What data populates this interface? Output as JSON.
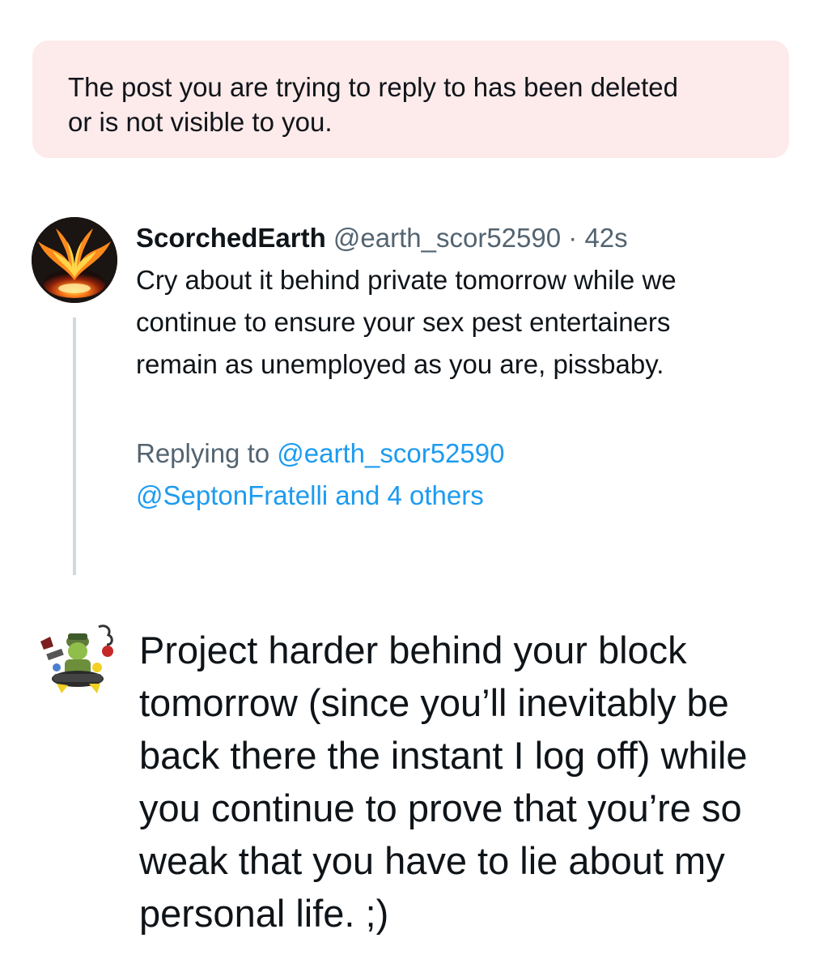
{
  "notice": {
    "text": "The post you are trying to reply to has been deleted or is not visible to you."
  },
  "parent_tweet": {
    "display_name": "ScorchedEarth",
    "handle": "@earth_scor52590",
    "separator": "·",
    "timestamp": "42s",
    "text": "Cry about it behind private tomorrow while we continue to ensure your sex pest entertainers remain as unemployed as you are, pissbaby.",
    "replying_to_label": "Replying to",
    "replying_to_handle": "@earth_scor52590",
    "replying_to_more": "@SeptonFratelli and 4 others"
  },
  "reply_draft": {
    "text": "Project harder behind your block tomorrow (since you’ll inevitably be back there the instant I log off) while you continue to prove that you’re so weak that you have to lie about my personal life. ;)"
  },
  "colors": {
    "notice_bg": "#fdeaea",
    "link": "#1d9bf0",
    "secondary_text": "#536471",
    "thread_line": "#cfd9de"
  }
}
